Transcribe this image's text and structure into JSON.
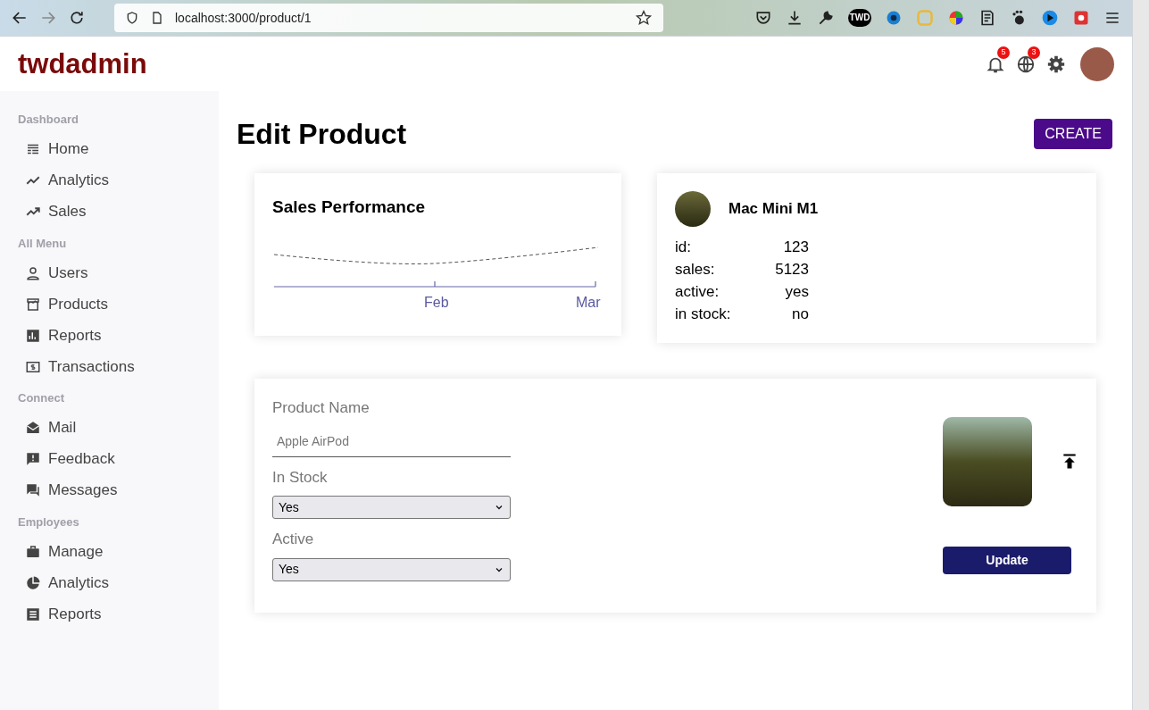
{
  "browser": {
    "address": "localhost:3000/product/1",
    "extension_badge": "TWD"
  },
  "header": {
    "logo": "twdadmin",
    "notifications": "5",
    "languages": "3"
  },
  "sidebar": {
    "sections": [
      {
        "title": "Dashboard",
        "items": [
          "Home",
          "Analytics",
          "Sales"
        ]
      },
      {
        "title": "All Menu",
        "items": [
          "Users",
          "Products",
          "Reports",
          "Transactions"
        ]
      },
      {
        "title": "Connect",
        "items": [
          "Mail",
          "Feedback",
          "Messages"
        ]
      },
      {
        "title": "Employees",
        "items": [
          "Manage",
          "Analytics",
          "Reports"
        ]
      }
    ]
  },
  "page": {
    "title": "Edit Product",
    "create_button": "CREATE"
  },
  "chart_card": {
    "title": "Sales Performance",
    "x_labels": [
      "Feb",
      "Mar"
    ]
  },
  "product_card": {
    "name": "Mac Mini M1",
    "fields": [
      {
        "label": "id:",
        "value": "123"
      },
      {
        "label": "sales:",
        "value": "5123"
      },
      {
        "label": "active:",
        "value": "yes"
      },
      {
        "label": "in stock:",
        "value": "no"
      }
    ]
  },
  "form": {
    "name_label": "Product Name",
    "name_placeholder": "Apple AirPod",
    "stock_label": "In Stock",
    "stock_value": "Yes",
    "active_label": "Active",
    "active_value": "Yes",
    "update_button": "Update"
  }
}
